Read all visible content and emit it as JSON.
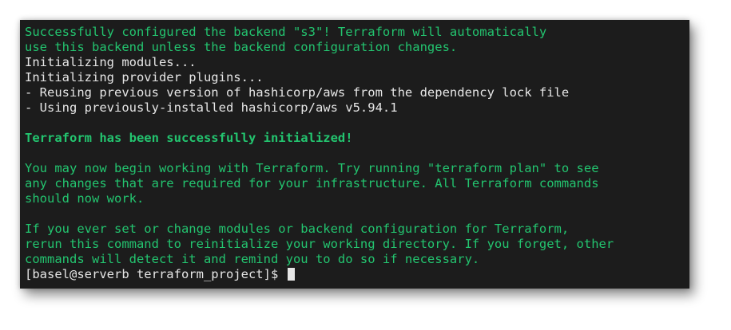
{
  "terminal": {
    "lines": [
      {
        "text": "Successfully configured the backend \"s3\"! Terraform will automatically",
        "color": "#23c46f"
      },
      {
        "text": "use this backend unless the backend configuration changes.",
        "color": "#23c46f"
      },
      {
        "text": "Initializing modules...",
        "color": "#e6e6e6"
      },
      {
        "text": "Initializing provider plugins...",
        "color": "#e6e6e6"
      },
      {
        "text": "- Reusing previous version of hashicorp/aws from the dependency lock file",
        "color": "#e6e6e6"
      },
      {
        "text": "- Using previously-installed hashicorp/aws v5.94.1",
        "color": "#e6e6e6"
      },
      {
        "text": "",
        "color": ""
      },
      {
        "text": "Terraform has been successfully initialized!",
        "color": "#23c46f"
      },
      {
        "text": "",
        "color": ""
      },
      {
        "text": "You may now begin working with Terraform. Try running \"terraform plan\" to see",
        "color": "#23c46f"
      },
      {
        "text": "any changes that are required for your infrastructure. All Terraform commands",
        "color": "#23c46f"
      },
      {
        "text": "should now work.",
        "color": "#23c46f"
      },
      {
        "text": "",
        "color": ""
      },
      {
        "text": "If you ever set or change modules or backend configuration for Terraform,",
        "color": "#23c46f"
      },
      {
        "text": "rerun this command to reinitialize your working directory. If you forget, other",
        "color": "#23c46f"
      },
      {
        "text": "commands will detect it and remind you to do so if necessary.",
        "color": "#23c46f"
      }
    ],
    "prompt": "[basel@serverb terraform_project]$ "
  }
}
